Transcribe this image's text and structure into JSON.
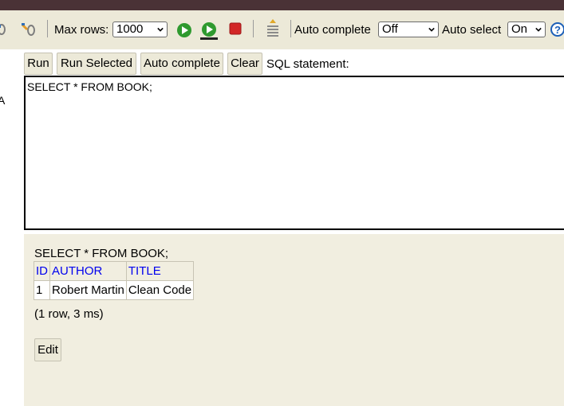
{
  "toolbar": {
    "max_rows_label": "Max rows:",
    "max_rows_value": "1000",
    "auto_complete_label": "Auto complete",
    "auto_complete_value": "Off",
    "auto_select_label": "Auto select",
    "auto_select_value": "On",
    "icons": [
      "refresh-icon",
      "disconnect-icon",
      "run-icon",
      "run-selected-icon",
      "stop-icon",
      "history-icon",
      "help-icon"
    ],
    "colors": {
      "run": "#2f9a2f",
      "stop": "#d22727",
      "help": "#1c5fb8",
      "bar": "#ece9d8",
      "titlebar": "#4a3236"
    }
  },
  "commands": {
    "run": "Run",
    "run_selected": "Run Selected",
    "auto_complete": "Auto complete",
    "clear": "Clear",
    "sql_label": "SQL statement:"
  },
  "left_fragment": "A",
  "editor": {
    "text": "SELECT * FROM BOOK;"
  },
  "result": {
    "statement": "SELECT * FROM BOOK;",
    "columns": [
      "ID",
      "AUTHOR",
      "TITLE"
    ],
    "rows": [
      [
        "1",
        "Robert Martin",
        "Clean Code"
      ]
    ],
    "summary": "(1 row, 3 ms)",
    "edit_label": "Edit"
  }
}
